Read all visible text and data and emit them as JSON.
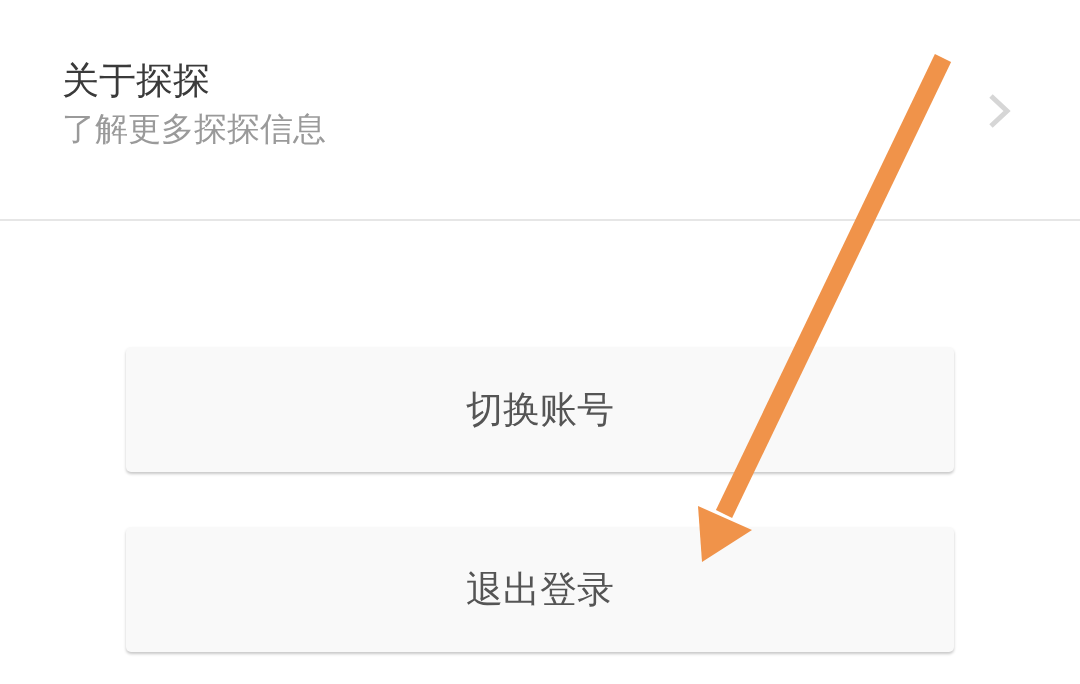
{
  "settings_item": {
    "title": "关于探探",
    "subtitle": "了解更多探探信息"
  },
  "buttons": [
    {
      "label": "切换账号"
    },
    {
      "label": "退出登录"
    }
  ]
}
